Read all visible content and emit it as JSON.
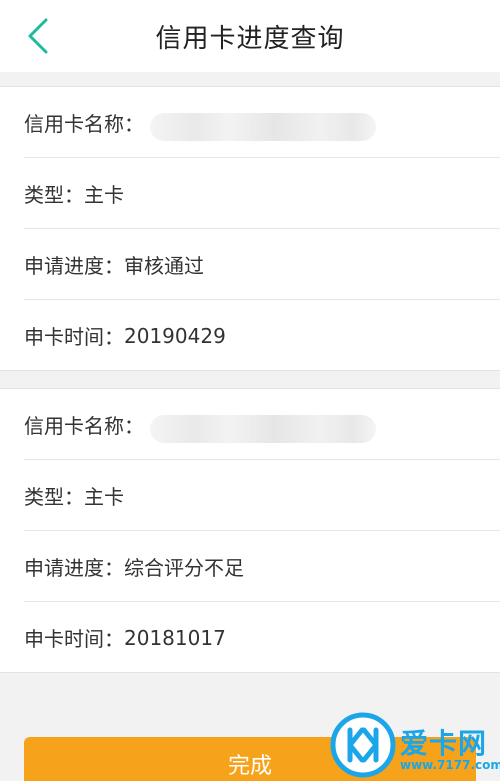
{
  "header": {
    "title": "信用卡进度查询"
  },
  "cards": [
    {
      "name_label": "信用卡名称：",
      "type_label": "类型：",
      "type_value": "主卡",
      "progress_label": "申请进度：",
      "progress_value": "审核通过",
      "time_label": "申卡时间：",
      "time_value": "20190429"
    },
    {
      "name_label": "信用卡名称：",
      "type_label": "类型：",
      "type_value": "主卡",
      "progress_label": "申请进度：",
      "progress_value": "综合评分不足",
      "time_label": "申卡时间：",
      "time_value": "20181017"
    }
  ],
  "footer": {
    "complete_label": "完成"
  },
  "watermark": {
    "brand": "爱卡网",
    "url": "www.7177.com"
  },
  "colors": {
    "accent_back": "#1abc9c",
    "button": "#f7a21b",
    "watermark": "#1aa6e8"
  },
  "icons": {
    "back": "chevron-left-icon",
    "logo": "watermark-logo-icon"
  }
}
